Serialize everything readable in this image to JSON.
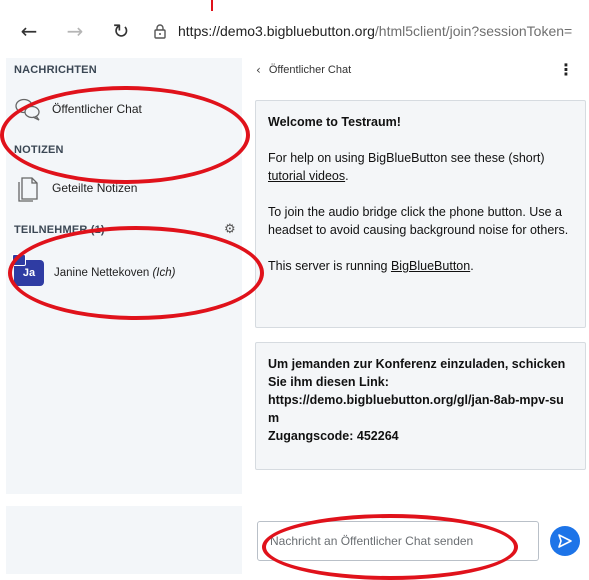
{
  "browser": {
    "url_host": "https://demo3.bigbluebutton.org",
    "url_path": "/html5client/join?sessionToken="
  },
  "sidebar": {
    "messages_title": "NACHRICHTEN",
    "public_chat_label": "Öffentlicher Chat",
    "notes_title": "NOTIZEN",
    "shared_notes_label": "Geteilte Notizen",
    "participants_title": "TEILNEHMER (1)",
    "user": {
      "initials": "Ja",
      "name": "Janine Nettekoven",
      "self_tag": "(Ich)"
    }
  },
  "chat": {
    "back_label": "Öffentlicher Chat",
    "welcome": {
      "line1_prefix": "Welcome to ",
      "room_name": "Testraum",
      "line1_suffix": "!",
      "help_prefix": "For help on using BigBlueButton see these (short) ",
      "help_link": "tutorial videos",
      "help_suffix": ".",
      "audio_text": "To join the audio bridge click the phone button. Use a headset to avoid causing background noise for others.",
      "server_prefix": "This server is running ",
      "server_link": "BigBlueButton",
      "server_suffix": "."
    },
    "invite": {
      "line1": "Um jemanden zur Konferenz einzuladen, schicken Sie ihm diesen Link:",
      "link": "https://demo.bigbluebutton.org/gl/jan-8ab-mpv-sum",
      "code": "Zugangscode: 452264"
    },
    "input_placeholder": "Nachricht an Öffentlicher Chat senden"
  },
  "colors": {
    "accent": "#1d74e8",
    "annotation": "#e0121b",
    "avatar": "#2f3ca3"
  }
}
